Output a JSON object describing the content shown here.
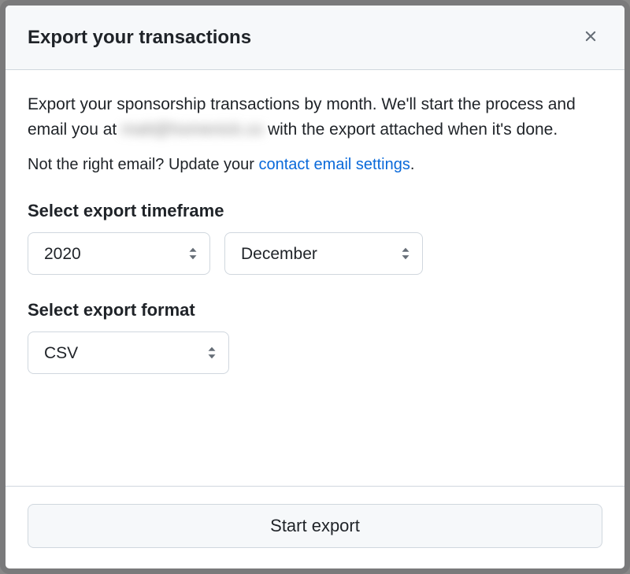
{
  "dialog": {
    "title": "Export your transactions",
    "description_prefix": "Export your sponsorship transactions by month. We'll start the process and email you at ",
    "description_email_masked": "matt@homenick.co",
    "description_suffix": " with the export attached when it's done.",
    "email_note_prefix": "Not the right email? Update your ",
    "email_note_link": "contact email settings",
    "email_note_suffix": "."
  },
  "timeframe": {
    "label": "Select export timeframe",
    "year_value": "2020",
    "month_value": "December"
  },
  "format": {
    "label": "Select export format",
    "value": "CSV"
  },
  "footer": {
    "start_label": "Start export"
  }
}
